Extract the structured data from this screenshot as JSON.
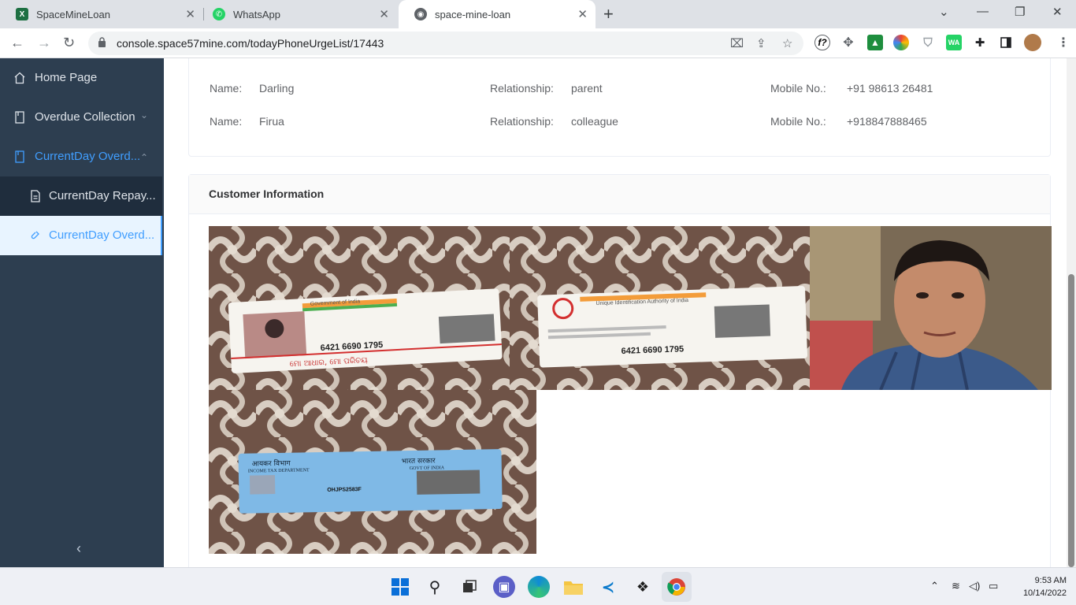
{
  "browser": {
    "tabs": [
      {
        "title": "SpaceMineLoan",
        "icon": "excel-icon"
      },
      {
        "title": "WhatsApp",
        "icon": "whatsapp-icon"
      },
      {
        "title": "space-mine-loan",
        "icon": "globe-icon"
      }
    ],
    "active_tab": 2,
    "url": "console.space57mine.com/todayPhoneUrgeList/17443"
  },
  "sidebar": {
    "items": [
      {
        "label": "Home Page",
        "icon": "home-icon"
      },
      {
        "label": "Overdue Collection",
        "icon": "document-icon"
      },
      {
        "label": "CurrentDay Overd...",
        "icon": "document-icon"
      },
      {
        "label": "CurrentDay Repay...",
        "icon": "file-icon"
      },
      {
        "label": "CurrentDay Overd...",
        "icon": "link-icon"
      }
    ],
    "collapse_label": "‹"
  },
  "contacts": {
    "name_label": "Name:",
    "relationship_label": "Relationship:",
    "mobile_label": "Mobile No.:",
    "rows": [
      {
        "name": "Darling",
        "relationship": "parent",
        "mobile": "+91 98613 26481"
      },
      {
        "name": "Firua",
        "relationship": "colleague",
        "mobile": "+918847888465"
      }
    ]
  },
  "customer_info": {
    "title": "Customer Information",
    "photos": [
      {
        "kind": "aadhaar-front",
        "number": "6421 6690 1795",
        "caption": "ମୋ ଆଧାର, ମୋ ପରିଚୟ",
        "header": "Government of India"
      },
      {
        "kind": "aadhaar-back",
        "number": "6421 6690 1795",
        "header": "Unique Identification Authority of India"
      },
      {
        "kind": "selfie"
      },
      {
        "kind": "pan-card",
        "header_left": "आयकर विभाग",
        "header_right": "भारत सरकार",
        "sub_left": "INCOME TAX DEPARTMENT",
        "sub_right": "GOVT OF INDIA",
        "pan": "OHJPS2583F"
      }
    ]
  },
  "taskbar": {
    "time": "9:53 AM",
    "date": "10/14/2022"
  },
  "colors": {
    "sidebar_bg": "#2d3e50",
    "accent": "#409eff"
  }
}
